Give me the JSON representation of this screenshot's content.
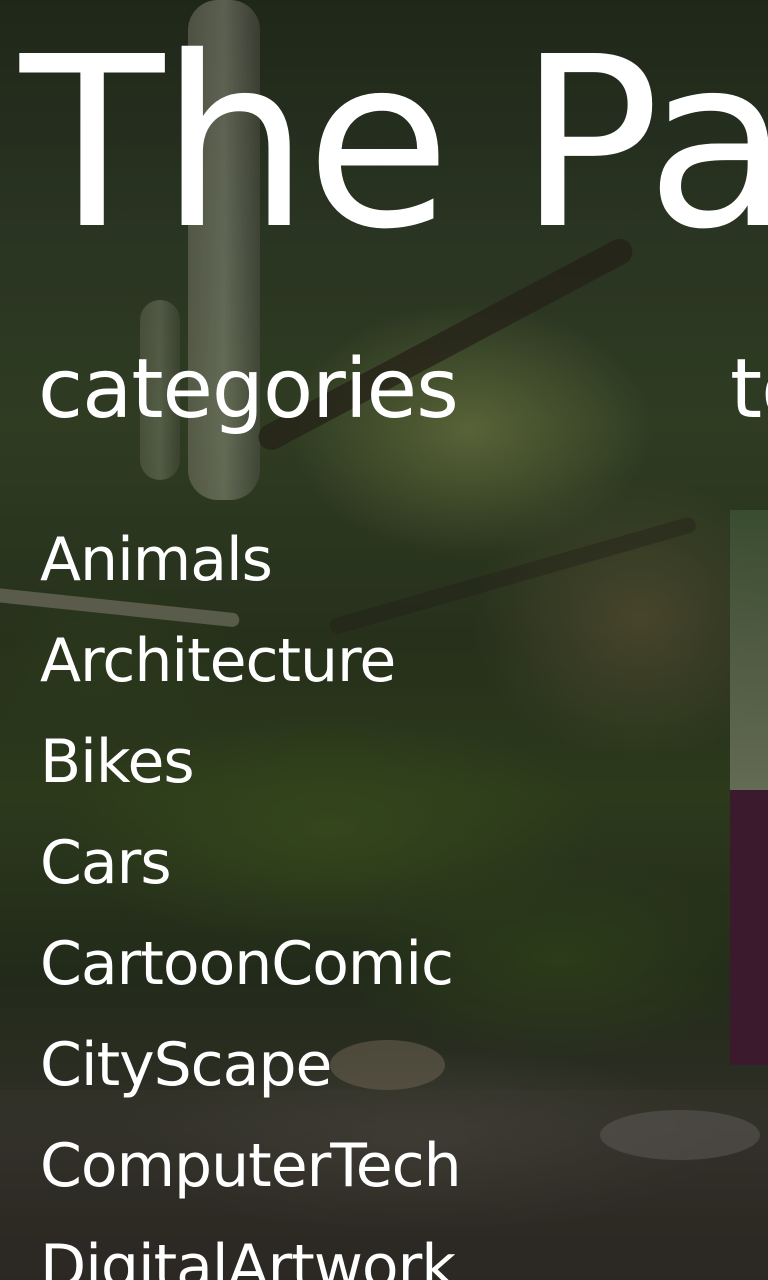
{
  "app": {
    "title": "The Paper"
  },
  "sections": {
    "current_header": "categories",
    "next_header": "top"
  },
  "categories": {
    "items": [
      {
        "label": "Animals"
      },
      {
        "label": "Architecture"
      },
      {
        "label": "Bikes"
      },
      {
        "label": "Cars"
      },
      {
        "label": "CartoonComic"
      },
      {
        "label": "CityScape"
      },
      {
        "label": "ComputerTech"
      },
      {
        "label": "DigitalArtwork"
      }
    ]
  },
  "colors": {
    "text": "#ffffff",
    "accent_tile": "#3a1a2c"
  },
  "background": {
    "icon": "forest-wallpaper"
  }
}
